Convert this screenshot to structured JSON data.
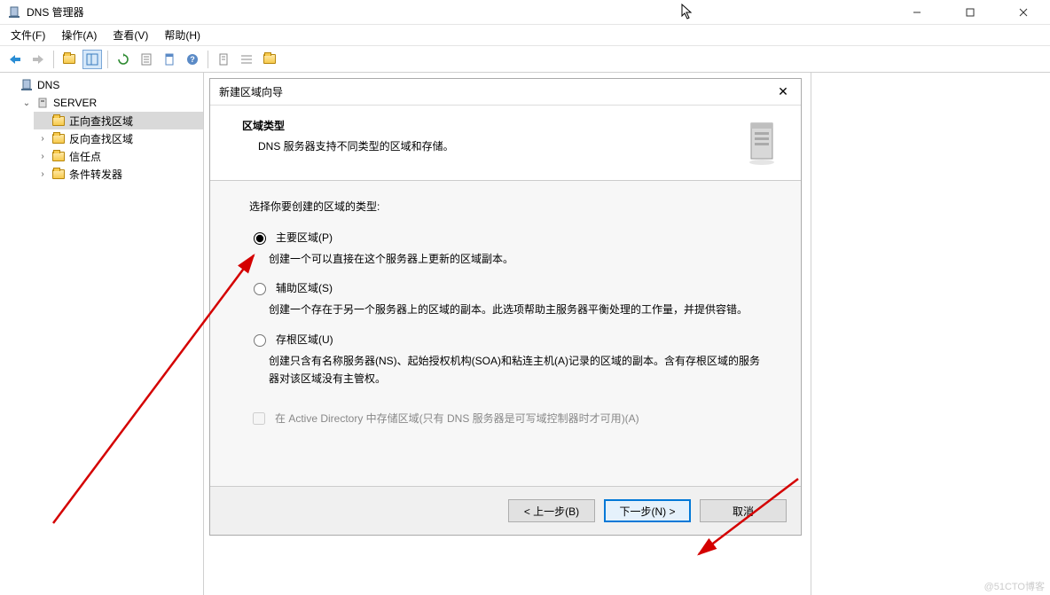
{
  "window": {
    "title": "DNS 管理器"
  },
  "menu": {
    "file": "文件(F)",
    "action": "操作(A)",
    "view": "查看(V)",
    "help": "帮助(H)"
  },
  "tree": {
    "root": "DNS",
    "server": "SERVER",
    "forward": "正向查找区域",
    "reverse": "反向查找区域",
    "trust": "信任点",
    "cond": "条件转发器"
  },
  "wizard": {
    "title": "新建区域向导",
    "banner_heading": "区域类型",
    "banner_sub": "DNS 服务器支持不同类型的区域和存储。",
    "prompt": "选择你要创建的区域的类型:",
    "opt1_label": "主要区域(P)",
    "opt1_desc": "创建一个可以直接在这个服务器上更新的区域副本。",
    "opt2_label": "辅助区域(S)",
    "opt2_desc": "创建一个存在于另一个服务器上的区域的副本。此选项帮助主服务器平衡处理的工作量，并提供容错。",
    "opt3_label": "存根区域(U)",
    "opt3_desc": "创建只含有名称服务器(NS)、起始授权机构(SOA)和粘连主机(A)记录的区域的副本。含有存根区域的服务器对该区域没有主管权。",
    "chk_label": "在 Active Directory 中存储区域(只有 DNS 服务器是可写域控制器时才可用)(A)",
    "btn_back": "< 上一步(B)",
    "btn_next": "下一步(N) >",
    "btn_cancel": "取消"
  },
  "watermark": "@51CTO博客"
}
